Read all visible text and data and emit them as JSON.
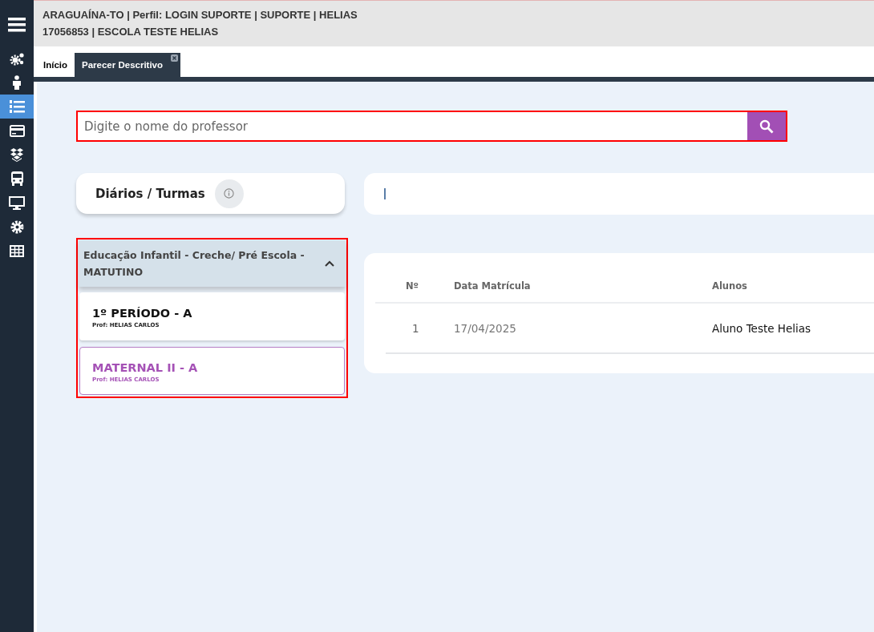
{
  "header": {
    "line_1": "ARAGUAÍNA-TO | Perfil: LOGIN SUPORTE | SUPORTE | HELIAS",
    "line_2": "17056853 | ESCOLA TESTE HELIAS"
  },
  "sidebar": {
    "items": [
      {
        "kind": "menu",
        "selected": false
      },
      {
        "kind": "gears",
        "selected": false
      },
      {
        "kind": "person",
        "selected": false
      },
      {
        "kind": "list",
        "selected": true
      },
      {
        "kind": "card",
        "selected": false
      },
      {
        "kind": "boxes",
        "selected": false
      },
      {
        "kind": "bus",
        "selected": false
      },
      {
        "kind": "monitor",
        "selected": false
      },
      {
        "kind": "gear",
        "selected": false
      },
      {
        "kind": "table",
        "selected": false
      }
    ]
  },
  "tabs": [
    {
      "label": "Início",
      "selected": false,
      "closable": false
    },
    {
      "label": "Parecer Descritivo",
      "selected": true,
      "closable": true
    }
  ],
  "search": {
    "placeholder": "Digite o nome do professor",
    "highlighted": true
  },
  "diarios_card": {
    "title": "Diários / Turmas"
  },
  "group": {
    "title": "Educação Infantil - Creche/ Pré Escola - MATUTINO",
    "expanded": true,
    "highlighted": true,
    "classes": [
      {
        "name": "1º PERÍODO - A",
        "teacher": "Prof: HELIAS CARLOS",
        "selected": false
      },
      {
        "name": "MATERNAL II - A",
        "teacher": "Prof: HELIAS CARLOS",
        "selected": true
      }
    ]
  },
  "table": {
    "columns": [
      "Nº",
      "Data Matrícula",
      "Alunos"
    ],
    "rows": [
      [
        "1",
        "17/04/2025",
        "Aluno Teste Helias"
      ]
    ]
  }
}
